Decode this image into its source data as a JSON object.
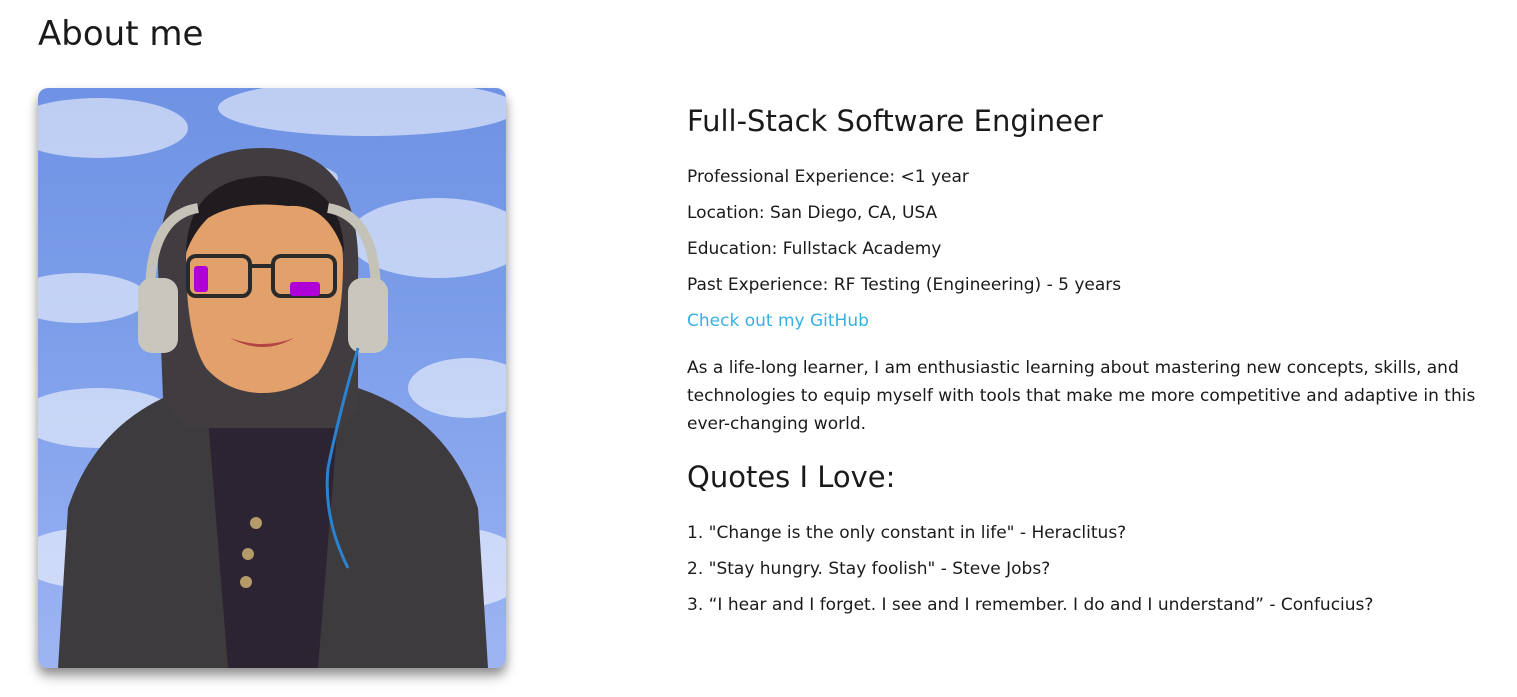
{
  "page": {
    "title": "About me"
  },
  "profile": {
    "job_title": "Full-Stack Software Engineer",
    "facts": [
      "Professional Experience: <1 year",
      "Location: San Diego, CA, USA",
      "Education: Fullstack Academy",
      "Past Experience: RF Testing (Engineering) - 5 years"
    ],
    "github_link": "Check out my GitHub",
    "bio": "As a life-long learner, I am enthusiastic learning about mastering new concepts, skills, and technologies to equip myself with tools that make me more competitive and adaptive in this ever-changing world."
  },
  "quotes": {
    "heading": "Quotes I Love:",
    "items": [
      "1. \"Change is the only constant in life\" - Heraclitus?",
      "2. \"Stay hungry. Stay foolish\" - Steve Jobs?",
      "3. “I hear and I forget. I see and I remember. I do and I understand” - Confucius?"
    ]
  },
  "colors": {
    "link": "#38b0e3",
    "text": "#1a1a1a",
    "background": "#ffffff"
  }
}
